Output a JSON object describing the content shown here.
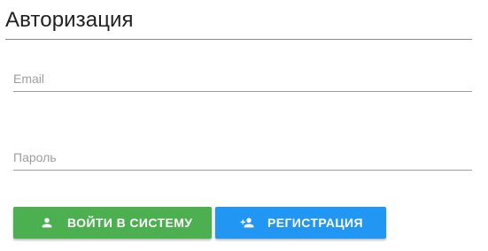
{
  "auth": {
    "title": "Авторизация",
    "email_placeholder": "Email",
    "password_placeholder": "Пароль",
    "login_button": {
      "label": "ВОЙТИ В СИСТЕМУ",
      "icon": "person-icon",
      "color": "#4caf50"
    },
    "register_button": {
      "label": "РЕГИСТРАЦИЯ",
      "icon": "person-add-icon",
      "color": "#2196f3"
    }
  }
}
